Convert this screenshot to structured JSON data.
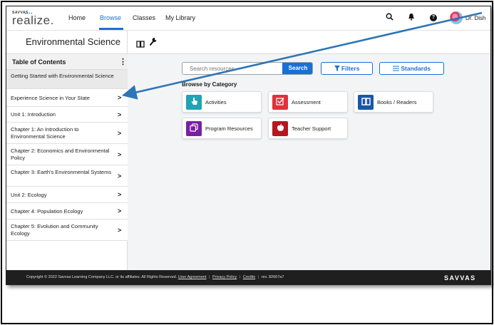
{
  "app": {
    "logo_brand": "SAVVAS",
    "logo_name": "realize."
  },
  "topnav": {
    "links": [
      "Home",
      "Browse",
      "Classes",
      "My Library"
    ],
    "user_name": "Dr. Dish"
  },
  "titlebar": {
    "course_title": "Environmental Science"
  },
  "sidebar": {
    "title": "Table of Contents",
    "menu_glyph": "⋮",
    "items": [
      {
        "label": "Getting Started with Environmental Science",
        "chevron": ""
      },
      {
        "label": "Experience Science in Your State",
        "chevron": ">"
      },
      {
        "label": "Unit 1: Introduction",
        "chevron": ">"
      },
      {
        "label": "Chapter 1: An Introduction to Environmental Science",
        "chevron": ">"
      },
      {
        "label": "Chapter 2: Economics and Environmental Policy",
        "chevron": ">"
      },
      {
        "label": "Chapter 3: Earth's Environmental Systems",
        "chevron": ">"
      },
      {
        "label": "Unit 2: Ecology",
        "chevron": ">"
      },
      {
        "label": "Chapter 4: Population Ecology",
        "chevron": ">"
      },
      {
        "label": "Chapter 5: Evolution and Community Ecology",
        "chevron": ">"
      }
    ]
  },
  "main": {
    "search": {
      "placeholder": "Search resources",
      "button": "Search"
    },
    "filters_label": "Filters",
    "standards_label": "Standards",
    "browse_heading": "Browse by Category",
    "categories": [
      {
        "label": "Activities",
        "icon": "pointer-hand-icon",
        "color": "#1fa3b5"
      },
      {
        "label": "Assessment",
        "icon": "checkbox-icon",
        "color": "#e0313b"
      },
      {
        "label": "Books / Readers",
        "icon": "open-book-icon",
        "color": "#1857a8"
      },
      {
        "label": "Program Resources",
        "icon": "stacked-pages-icon",
        "color": "#7a1fa2"
      },
      {
        "label": "Teacher Support",
        "icon": "apple-icon",
        "color": "#b5171f"
      }
    ]
  },
  "footer": {
    "copyright": "Copyright © 2022 Savvas Learning Company LLC. or its affiliates. All Rights Reserved.",
    "user_agreement": "User Agreement",
    "privacy_policy": "Privacy Policy",
    "credits": "Credits",
    "rev": "rev. 82667a7",
    "logo": "SAVVAS"
  },
  "colors": {
    "accent": "#1a6fd6",
    "annotation_arrow": "#2e75b6"
  }
}
